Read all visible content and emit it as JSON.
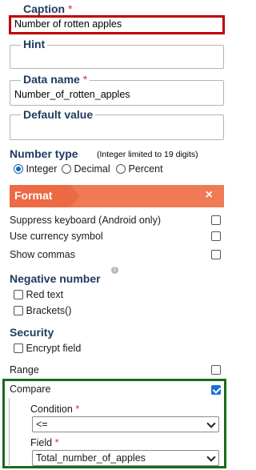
{
  "caption": {
    "label": "Caption",
    "required": "*",
    "value": "Number of rotten apples"
  },
  "hint": {
    "label": "Hint",
    "value": ""
  },
  "data_name": {
    "label": "Data name",
    "required": "*",
    "value": "Number_of_rotten_apples"
  },
  "default_value": {
    "label": "Default value",
    "value": ""
  },
  "number_type": {
    "title": "Number type",
    "note": "(Integer limited to 19 digits)",
    "options": [
      "Integer",
      "Decimal",
      "Percent"
    ],
    "selected": "Integer"
  },
  "format_banner": {
    "label": "Format",
    "close": "×"
  },
  "options": {
    "suppress_keyboard": "Suppress keyboard (Android only)",
    "currency_symbol": "Use currency symbol",
    "show_commas": "Show commas"
  },
  "negative_number": {
    "title": "Negative number",
    "info": "i",
    "red_text": "Red text",
    "brackets": "Brackets()"
  },
  "security": {
    "title": "Security",
    "encrypt": "Encrypt field"
  },
  "range": {
    "label": "Range"
  },
  "compare": {
    "label": "Compare",
    "checked": true,
    "condition_label": "Condition",
    "condition_required": "*",
    "condition_value": "<=",
    "field_label": "Field",
    "field_required": "*",
    "field_value": "Total_number_of_apples"
  },
  "colors": {
    "caption_highlight": "#c00000",
    "compare_highlight": "#1a6b1a",
    "format_banner": "#f07a55",
    "accent": "#1e6fd9",
    "heading": "#1e3a5f"
  }
}
